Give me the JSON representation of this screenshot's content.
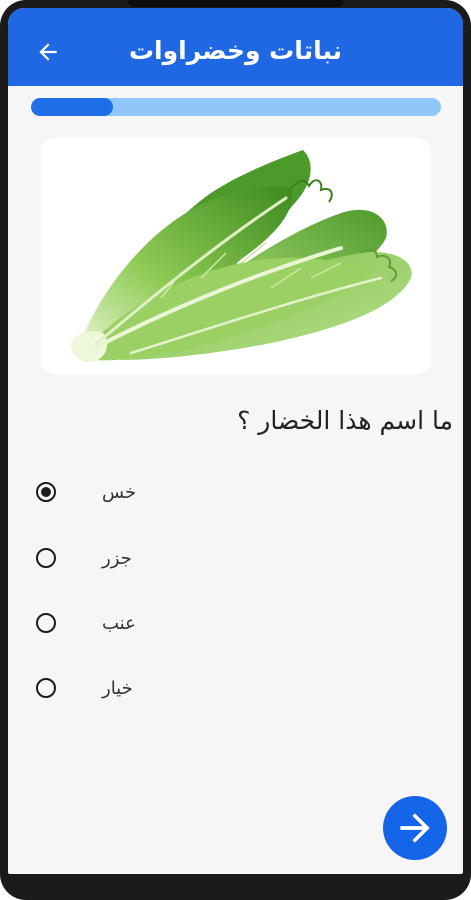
{
  "app_bar": {
    "title": "نباتات وخضراوات",
    "back_icon": "arrow-back-icon",
    "background_color": "#2068e3"
  },
  "progress": {
    "value": 0.2,
    "fill_color": "#1e6ee8",
    "track_color": "#90c6f8"
  },
  "image": {
    "subject": "lettuce"
  },
  "question": {
    "text": "ما اسم هذا الخضار ؟"
  },
  "options": [
    {
      "label": "خس",
      "selected": true
    },
    {
      "label": "جزر",
      "selected": false
    },
    {
      "label": "عنب",
      "selected": false
    },
    {
      "label": "خيار",
      "selected": false
    }
  ],
  "next_button": {
    "icon": "arrow-forward-icon",
    "color": "#1565e8"
  }
}
